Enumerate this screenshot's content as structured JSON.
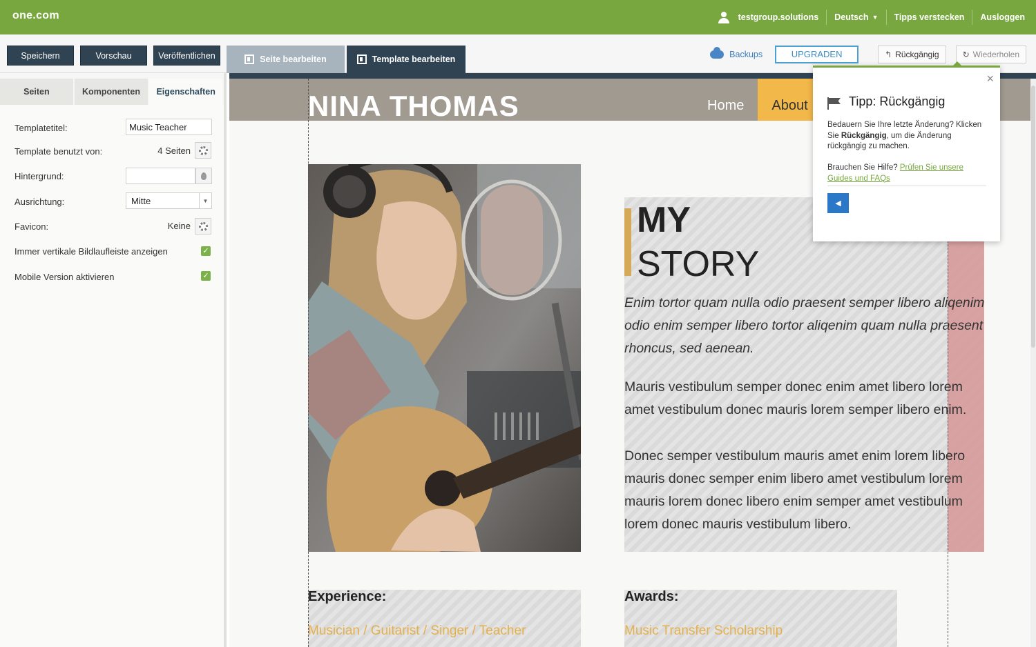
{
  "topbar": {
    "logo": "one.com",
    "user": "testgroup.solutions",
    "language": "Deutsch",
    "hide_tips": "Tipps verstecken",
    "logout": "Ausloggen",
    "color": "#77a73e"
  },
  "toolbar": {
    "save": "Speichern",
    "preview": "Vorschau",
    "publish": "Veröffentlichen",
    "edit_page": "Seite bearbeiten",
    "edit_template": "Template bearbeiten",
    "backups": "Backups",
    "upgrade": "UPGRADEN",
    "undo": "Rückgängig",
    "redo": "Wiederholen"
  },
  "sidebar": {
    "tabs": [
      "Seiten",
      "Komponenten",
      "Eigenschaften"
    ],
    "active_tab": "Eigenschaften",
    "props": {
      "template_title_label": "Templatetitel:",
      "template_title_value": "Music Teacher",
      "used_by_label": "Template benutzt von:",
      "used_by_value": "4 Seiten",
      "background_label": "Hintergrund:",
      "background_value": "",
      "alignment_label": "Ausrichtung:",
      "alignment_value": "Mitte",
      "favicon_label": "Favicon:",
      "favicon_value": "Keine",
      "scrollbar_label": "Immer vertikale Bildlaufleiste anzeigen",
      "scrollbar_checked": true,
      "mobile_label": "Mobile Version aktivieren",
      "mobile_checked": true
    }
  },
  "site": {
    "name": "NINA THOMAS",
    "nav": [
      "Home",
      "About"
    ],
    "active_nav": "About",
    "story_title_1": "MY",
    "story_title_2": "STORY",
    "intro": "Enim tortor quam nulla odio praesent semper libero aliqenim odio enim semper libero tortor aliqenim quam nulla praesent rhoncus, sed aenean.",
    "para1": "Mauris vestibulum semper donec enim amet libero lorem amet vestibulum donec mauris lorem semper libero enim.",
    "para2": "Donec semper vestibulum mauris amet enim  lorem libero mauris donec semper enim libero amet vestibulum lorem mauris lorem donec libero enim semper amet vestibulum lorem donec mauris vestibulum libero.",
    "experience_title": "Experience:",
    "experience_value": "Musician / Guitarist / Singer / Teacher",
    "awards_title": "Awards:",
    "awards_value": "Music Transfer Scholarship",
    "accent_color": "#f3b84a"
  },
  "tip": {
    "title": "Tipp: Rückgängig",
    "text_before": "Bedauern Sie Ihre letzte Änderung? Klicken Sie ",
    "text_bold": "Rückgängig",
    "text_after": ", um die Änderung rückgängig zu machen.",
    "help_prefix": "Brauchen Sie Hilfe? ",
    "help_link": "Prüfen Sie unsere Guides und FAQs",
    "close": "×",
    "prev_arrow": "◀"
  }
}
